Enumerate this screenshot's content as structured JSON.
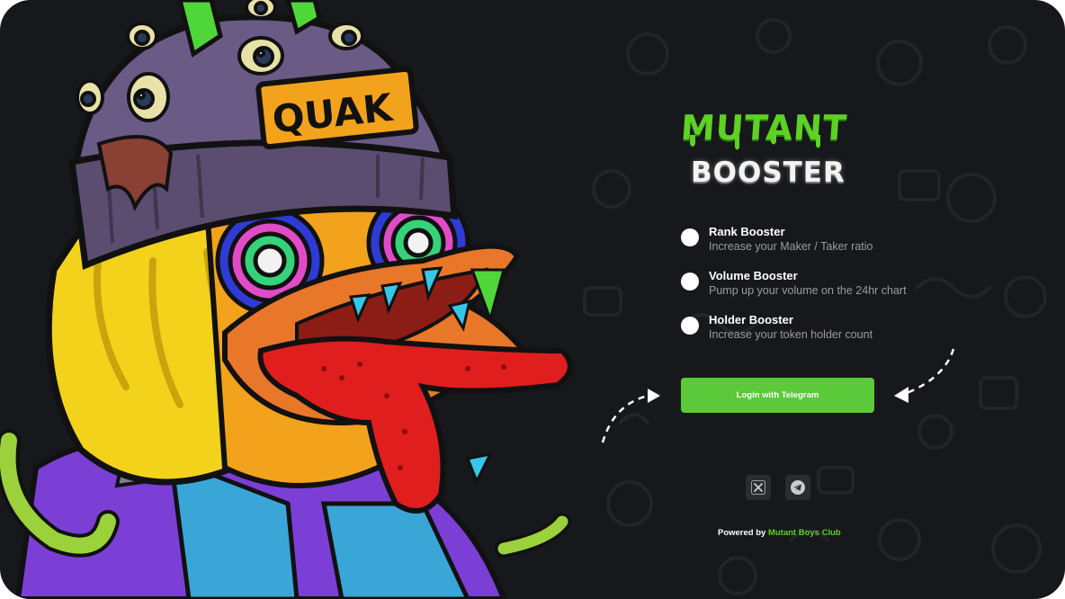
{
  "logo": {
    "line1": "MUTANT",
    "line2": "BOOSTER"
  },
  "hat_label": "QUAK",
  "features": [
    {
      "title": "Rank Booster",
      "description": "Increase your Maker / Taker ratio"
    },
    {
      "title": "Volume Booster",
      "description": "Pump up your volume on the 24hr chart"
    },
    {
      "title": "Holder Booster",
      "description": "Increase your token holder count"
    }
  ],
  "login_label": "Login with Telegram",
  "socials": [
    {
      "icon": "x-icon"
    },
    {
      "icon": "telegram-icon"
    }
  ],
  "footer": {
    "prefix": "Powered by",
    "brand": "Mutant Boys Club"
  },
  "colors": {
    "background": "#17181b",
    "accent": "#5bc93a",
    "logo_green": "#5ed125"
  }
}
